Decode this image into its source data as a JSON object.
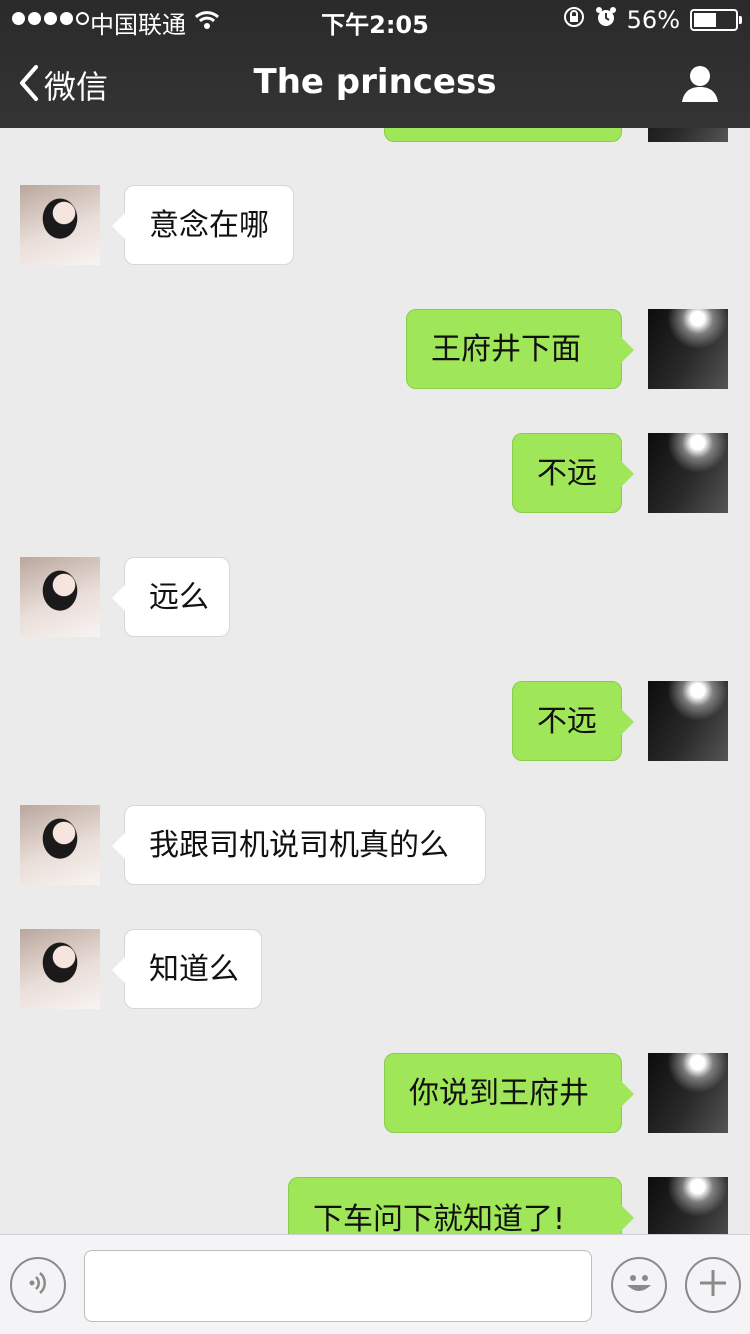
{
  "status_bar": {
    "carrier": "中国联通",
    "time": "下午2:05",
    "battery": "56%",
    "battery_level": 0.56
  },
  "nav": {
    "back_label": "微信",
    "title": "The princess"
  },
  "messages": [
    {
      "side": "right",
      "text": ""
    },
    {
      "side": "left",
      "text": "意念在哪"
    },
    {
      "side": "right",
      "text": "王府井下面"
    },
    {
      "side": "right",
      "text": "不远"
    },
    {
      "side": "left",
      "text": "远么"
    },
    {
      "side": "right",
      "text": "不远"
    },
    {
      "side": "left",
      "text": "我跟司机说司机真的么"
    },
    {
      "side": "left",
      "text": "知道么"
    },
    {
      "side": "right",
      "text": "你说到王府井"
    },
    {
      "side": "right",
      "text": "下车问下就知道了!"
    }
  ],
  "input": {
    "value": "",
    "placeholder": ""
  },
  "icons": {
    "voice": "voice-icon",
    "emoji": "emoji-icon",
    "plus": "plus-icon",
    "profile": "profile-icon",
    "back": "chevron-left-icon"
  },
  "colors": {
    "sent_bubble": "#9fe658",
    "received_bubble": "#ffffff",
    "nav_background": "#343434",
    "chat_background": "#ebebeb"
  }
}
